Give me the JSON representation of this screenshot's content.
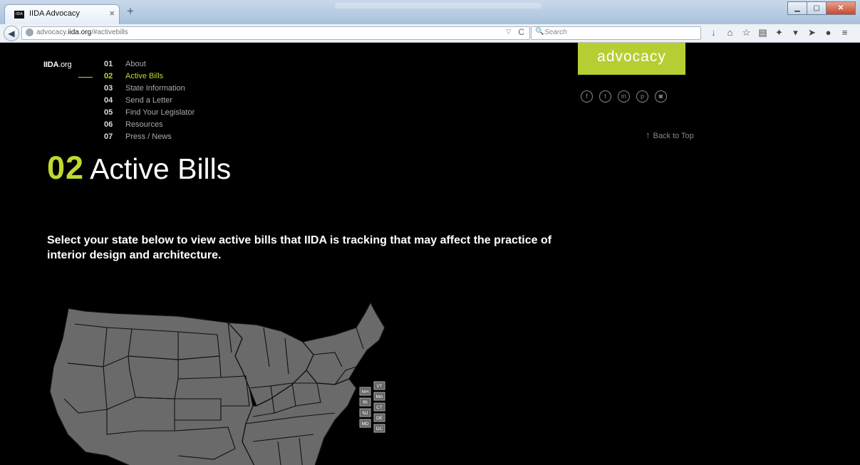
{
  "browser": {
    "tab_title": "IIDA Advocacy",
    "tab_favicon_text": "IIDA",
    "url_prefix": "advocacy.",
    "url_domain": "iida.org",
    "url_suffix": "/#activebills",
    "search_placeholder": "Search"
  },
  "site": {
    "logo_bold": "IIDA",
    "logo_rest": ".org",
    "badge": "advocacy",
    "back_to_top": "Back to Top",
    "accent_color": "#c3d82f"
  },
  "nav": [
    {
      "num": "01",
      "label": "About"
    },
    {
      "num": "02",
      "label": "Active Bills"
    },
    {
      "num": "03",
      "label": "State Information"
    },
    {
      "num": "04",
      "label": "Send a Letter"
    },
    {
      "num": "05",
      "label": "Find Your Legislator"
    },
    {
      "num": "06",
      "label": "Resources"
    },
    {
      "num": "07",
      "label": "Press / News"
    }
  ],
  "social": [
    "facebook-icon",
    "twitter-icon",
    "linkedin-icon",
    "pinterest-icon",
    "instagram-icon"
  ],
  "section": {
    "number": "02",
    "title": "Active Bills",
    "intro": "Select your state below to view active bills that IIDA is tracking that may affect the practice of interior design and architecture."
  },
  "small_states": [
    "VT",
    "NH",
    "MA",
    "RI",
    "CT",
    "NJ",
    "DE",
    "MD",
    "DC"
  ]
}
